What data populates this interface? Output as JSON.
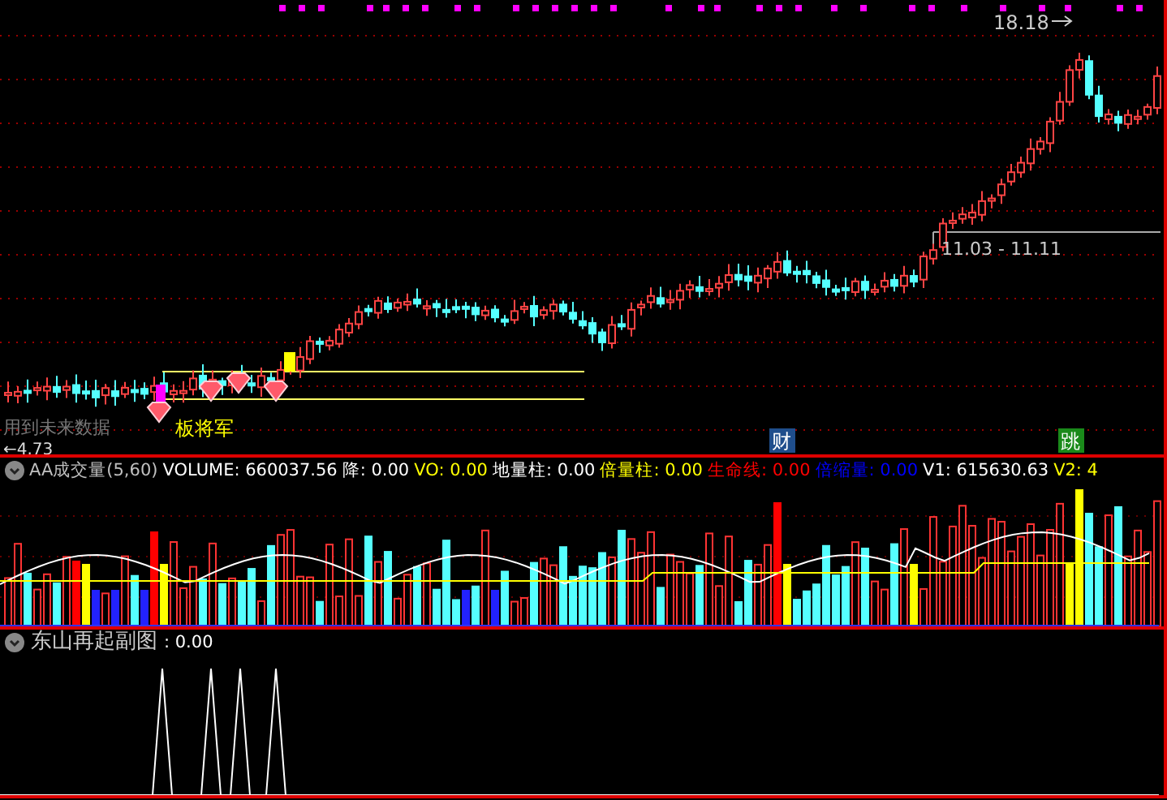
{
  "main_chart": {
    "labels": {
      "high_price": "18.18",
      "low_price": "←4.73",
      "range": "11.03 - 11.11",
      "signal": "板将军",
      "overlay": "用到未来数据"
    },
    "badges": [
      {
        "text": "财",
        "color": "#1f4e8c"
      },
      {
        "text": "跳",
        "color": "#1a8a1a"
      }
    ]
  },
  "volume_panel": {
    "legend": [
      {
        "text": "AA成交量(5,60)",
        "color": "#c0c0c0"
      },
      {
        "text": "VOLUME: 660037.56",
        "color": "#ffffff"
      },
      {
        "text": "降: 0.00",
        "color": "#ffffff"
      },
      {
        "text": "VO: 0.00",
        "color": "#ffff00"
      },
      {
        "text": "地量柱: 0.00",
        "color": "#ffffff"
      },
      {
        "text": "倍量柱: 0.00",
        "color": "#ffff00"
      },
      {
        "text": "生命线: 0.00",
        "color": "#ff0000"
      },
      {
        "text": "倍缩量: 0.00",
        "color": "#0000ff"
      },
      {
        "text": "V1: 615630.63",
        "color": "#ffffff"
      },
      {
        "text": "V2: 4",
        "color": "#ffff00"
      }
    ]
  },
  "sub_panel": {
    "title": "东山再起副图",
    "value": ": 0.00"
  }
}
